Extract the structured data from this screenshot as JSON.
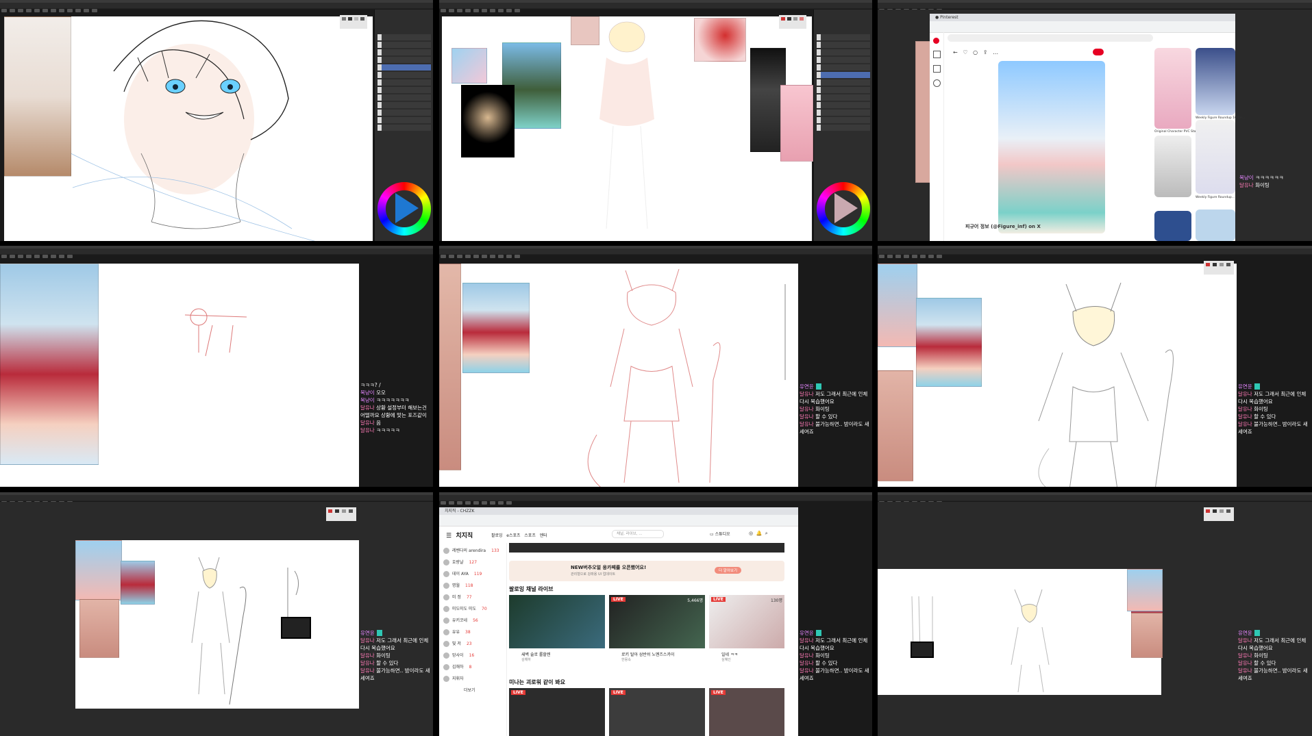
{
  "tiles": {
    "t2": {
      "chat": [
        {
          "nick": "복냥이",
          "msg": "ㅋㅋㅋㅋㅋㅋ",
          "style": "nick"
        },
        {
          "nick": "달유나",
          "msg": "화이팅",
          "style": "nick2"
        }
      ]
    },
    "t3": {
      "chat": [
        {
          "nick": "복냥이",
          "msg": "오오",
          "style": "nick"
        },
        {
          "nick": "복냥이",
          "msg": "ㅋㅋㅋㅋㅋㅋㅋ",
          "style": "nick"
        },
        {
          "nick": "달유나",
          "msg": "상황 설정부터 해보는건 어떨까요 상황에 맞는 포즈같이",
          "style": "nick2"
        },
        {
          "nick": "달유나",
          "msg": "음",
          "style": "nick2"
        },
        {
          "nick": "달유나",
          "msg": "ㅋㅋㅋㅋㅋ",
          "style": "nick2"
        }
      ]
    },
    "shared_chat": [
      {
        "nick": "유연윤",
        "msg": "",
        "style": "nick",
        "tag": true
      },
      {
        "nick": "달유나",
        "msg": "저도 그래서 최근에 인체 다시 복습했어요",
        "style": "nick2"
      },
      {
        "nick": "달유나",
        "msg": "화이팅",
        "style": "nick2"
      },
      {
        "nick": "달유나",
        "msg": "할 수 있다",
        "style": "nick2"
      },
      {
        "nick": "달유나",
        "msg": "불가능하면.. 밤이라도 새세여죠",
        "style": "nick2"
      }
    ],
    "t8": {
      "browser_tab": "치지직 - CHZZK",
      "logo": "치지직",
      "menu": [
        "팔로잉",
        "e스포츠",
        "스포츠",
        "엔터"
      ],
      "search_placeholder": "채널, 라이브, ...",
      "studio": "스튜디오",
      "banner_text": "NEW버추오얼 웅카페를 오픈했어요!",
      "banner_sub": "관리형으로 강좌용 UI 업데이트",
      "banner_btn": "더 알아보기",
      "section_title": "팔로잉 채널 라이브",
      "section2_title": "미나는 괴로워 같이 봐요",
      "sidebar": [
        {
          "name": "레벤다의 arendira",
          "v": "133"
        },
        {
          "name": "호랑날",
          "v": "127"
        },
        {
          "name": "데이 AYA",
          "v": "119"
        },
        {
          "name": "명월",
          "v": "118"
        },
        {
          "name": "미 정",
          "v": "77"
        },
        {
          "name": "미도미도 미도",
          "v": "70"
        },
        {
          "name": "유키코네",
          "v": "56"
        },
        {
          "name": "유유",
          "v": "38"
        },
        {
          "name": "빛 저",
          "v": "23"
        },
        {
          "name": "망사이",
          "v": "16"
        },
        {
          "name": "김해하",
          "v": "8"
        },
        {
          "name": "지휘자",
          "v": ""
        }
      ],
      "more": "더보기",
      "streams": [
        {
          "title": "새벽 술로 롤할렌",
          "user": "김해하",
          "cnt": ""
        },
        {
          "title": "로키 탈아 삼반쉬 노멘즈스카이",
          "user": "한몽속",
          "cnt": "5,466명"
        },
        {
          "title": "일네 ㅋㅋ",
          "user": "심혜인",
          "cnt": "130명"
        }
      ]
    },
    "t6": {
      "pin_title": "피규어 정보 (@Figure_inf) on X",
      "cap1": "Original Character PVC Statue...",
      "cap2": "Weekly Figure Roundup 16 De...",
      "cap3": "Weekly Figure Roundup..."
    }
  }
}
